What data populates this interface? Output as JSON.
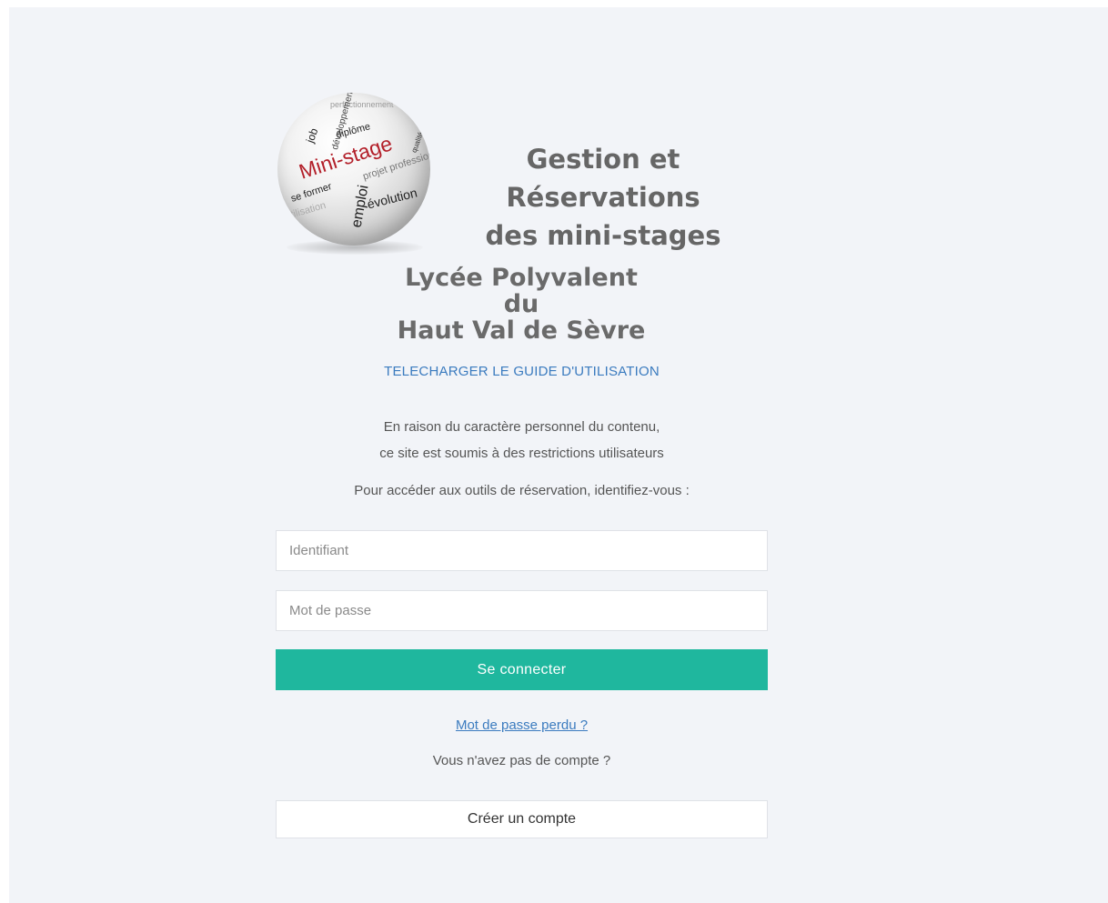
{
  "header": {
    "title_line1": "Gestion et Réservations",
    "title_line2": "des mini-stages"
  },
  "logo": {
    "main_word": "Mini-stage",
    "words": [
      "job",
      "diplôme",
      "développement",
      "évolution",
      "emploi",
      "se former",
      "projet professionnel",
      "perfectionnement",
      "utilisation",
      "qualité"
    ]
  },
  "school": {
    "line1": "Lycée Polyvalent",
    "line2": "du",
    "line3": "Haut Val de Sèvre"
  },
  "guide_link": "TELECHARGER LE GUIDE D'UTILISATION",
  "notice": {
    "line1": "En raison du caractère personnel du contenu,",
    "line2": "ce site est soumis à des restrictions utilisateurs"
  },
  "instruction": "Pour accéder aux outils de réservation, identifiez-vous :",
  "form": {
    "username_placeholder": "Identifiant",
    "password_placeholder": "Mot de passe",
    "submit_label": "Se connecter"
  },
  "lost_password": "Mot de passe perdu ?",
  "no_account": "Vous n'avez pas de compte ?",
  "create_account": "Créer un compte",
  "colors": {
    "accent": "#1fb79e",
    "link": "#3b7bbf",
    "logo_red": "#b3202a",
    "background": "#f2f4f8"
  }
}
